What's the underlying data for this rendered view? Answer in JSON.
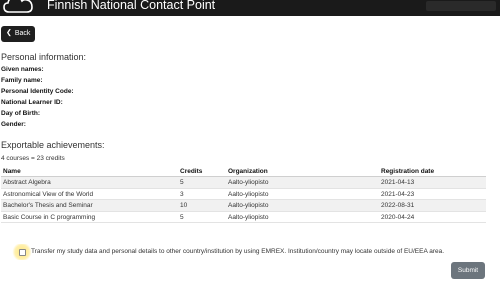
{
  "header": {
    "logo_icon": "cloud-logo",
    "title": "Finnish National Contact Point"
  },
  "back_button": {
    "label": "Back",
    "icon": "chevron-left-icon"
  },
  "personal": {
    "title": "Personal information:",
    "fields": [
      {
        "label": "Given names:",
        "value": ""
      },
      {
        "label": "Family name:",
        "value": ""
      },
      {
        "label": "Personal Identity Code:",
        "value": ""
      },
      {
        "label": "National Learner ID:",
        "value": ""
      },
      {
        "label": "Day of Birth:",
        "value": ""
      },
      {
        "label": "Gender:",
        "value": ""
      }
    ]
  },
  "achievements": {
    "title": "Exportable achievements:",
    "summary": "4 courses = 23 credits",
    "columns": [
      "Name",
      "Credits",
      "Organization",
      "Registration date"
    ],
    "rows": [
      [
        "Abstract Algebra",
        "5",
        "Aalto-yliopisto",
        "2021-04-13"
      ],
      [
        "Astronomical View of the World",
        "3",
        "Aalto-yliopisto",
        "2021-04-23"
      ],
      [
        "Bachelor's Thesis and Seminar",
        "10",
        "Aalto-yliopisto",
        "2022-08-31"
      ],
      [
        "Basic Course in C programming",
        "5",
        "Aalto-yliopisto",
        "2020-04-24"
      ]
    ]
  },
  "transfer": {
    "checked": false,
    "text": "Transfer my study data and personal details to other country/institution by using EMREX. Institution/country may locate outside of EU/EEA area."
  },
  "submit_button": {
    "label": "Submit"
  },
  "colors": {
    "topbar": "#1a1a1a",
    "button_dark": "#1f1f1f",
    "submit": "#6c757d",
    "stripe": "#f1f1f1"
  }
}
